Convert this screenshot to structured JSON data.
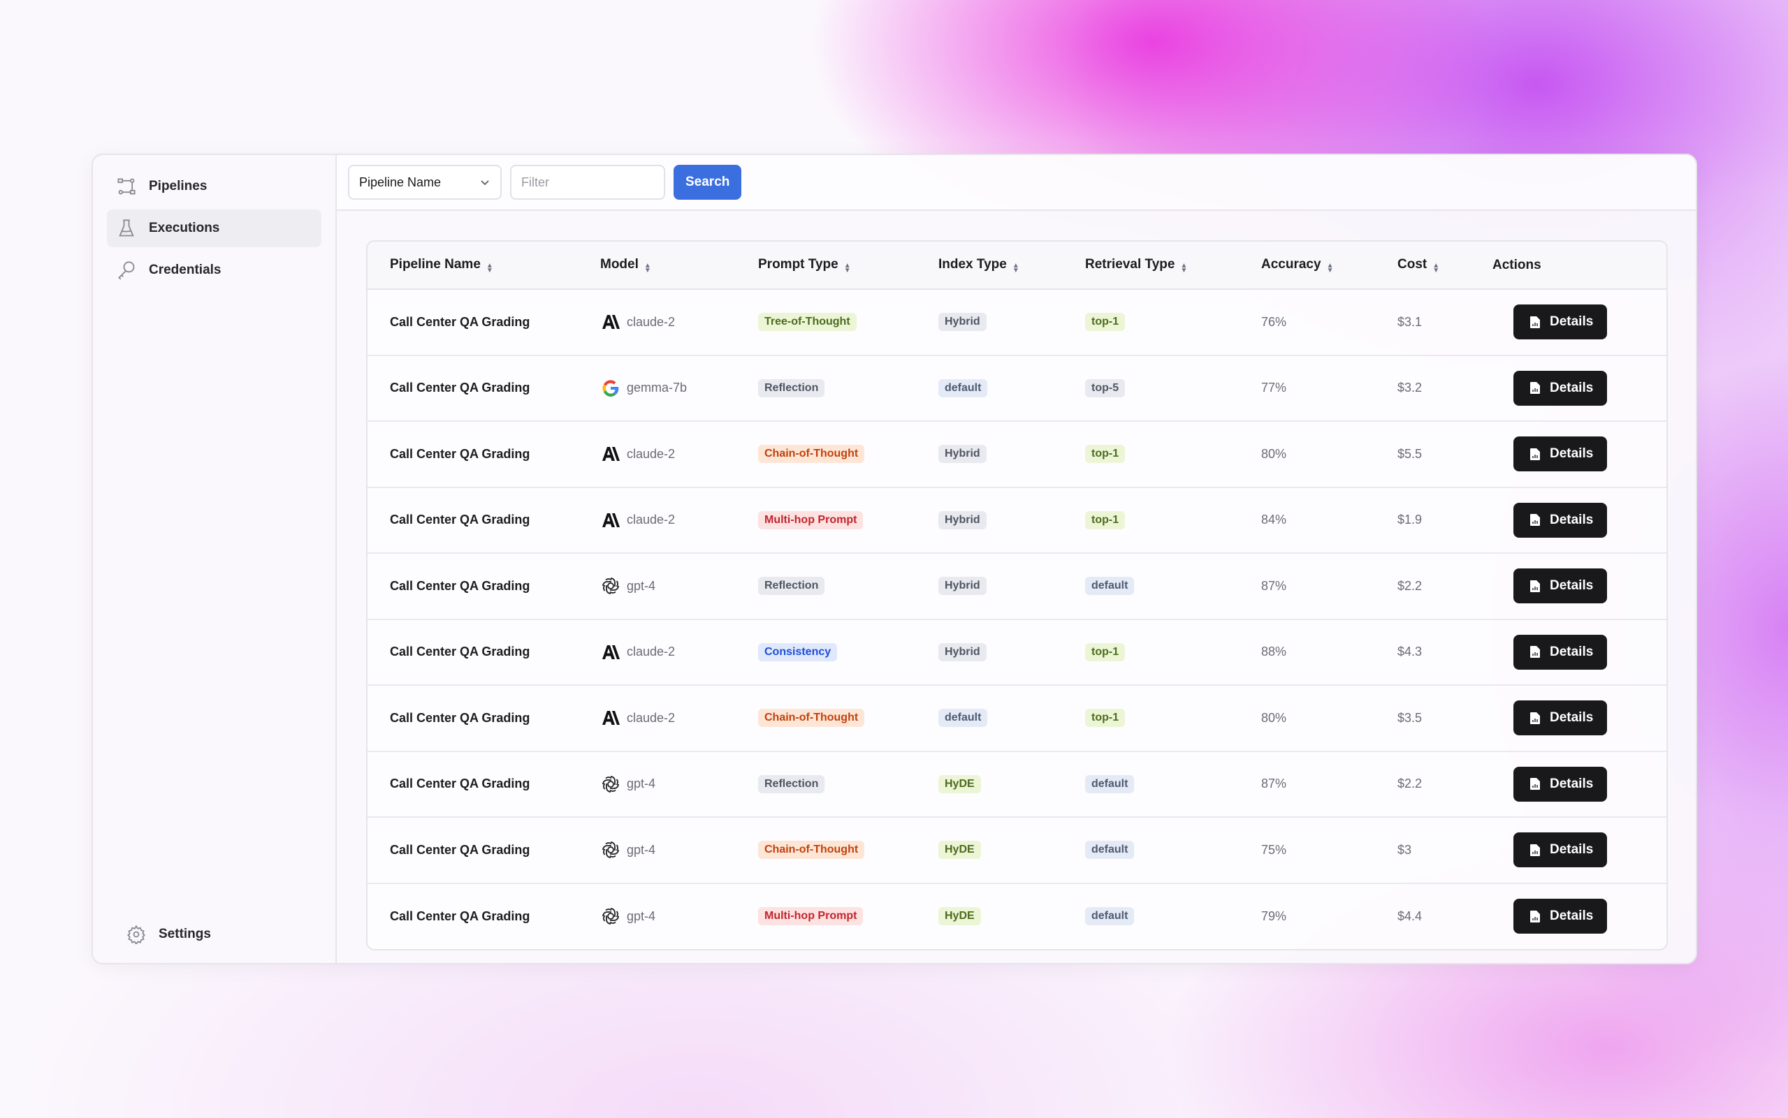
{
  "sidebar": {
    "items": [
      {
        "label": "Pipelines",
        "icon": "pipeline-icon"
      },
      {
        "label": "Executions",
        "icon": "flask-icon",
        "active": true
      },
      {
        "label": "Credentials",
        "icon": "key-icon"
      }
    ],
    "settings": {
      "label": "Settings",
      "icon": "gear-icon"
    }
  },
  "toolbar": {
    "select_value": "Pipeline Name",
    "filter_placeholder": "Filter",
    "search_label": "Search"
  },
  "table": {
    "columns": [
      "Pipeline Name",
      "Model",
      "Prompt Type",
      "Index Type",
      "Retrieval Type",
      "Accuracy",
      "Cost",
      "Actions"
    ],
    "action_label": "Details",
    "rows": [
      {
        "pipeline": "Call Center QA Grading",
        "model": "claude-2",
        "model_icon": "anthropic",
        "prompt": "Tree-of-Thought",
        "index": "Hybrid",
        "retrieval": "top-1",
        "accuracy": "76%",
        "cost": "$3.1"
      },
      {
        "pipeline": "Call Center QA Grading",
        "model": "gemma-7b",
        "model_icon": "google",
        "prompt": "Reflection",
        "index": "default",
        "retrieval": "top-5",
        "accuracy": "77%",
        "cost": "$3.2"
      },
      {
        "pipeline": "Call Center QA Grading",
        "model": "claude-2",
        "model_icon": "anthropic",
        "prompt": "Chain-of-Thought",
        "index": "Hybrid",
        "retrieval": "top-1",
        "accuracy": "80%",
        "cost": "$5.5"
      },
      {
        "pipeline": "Call Center QA Grading",
        "model": "claude-2",
        "model_icon": "anthropic",
        "prompt": "Multi-hop Prompt",
        "index": "Hybrid",
        "retrieval": "top-1",
        "accuracy": "84%",
        "cost": "$1.9"
      },
      {
        "pipeline": "Call Center QA Grading",
        "model": "gpt-4",
        "model_icon": "openai",
        "prompt": "Reflection",
        "index": "Hybrid",
        "retrieval": "default",
        "accuracy": "87%",
        "cost": "$2.2"
      },
      {
        "pipeline": "Call Center QA Grading",
        "model": "claude-2",
        "model_icon": "anthropic",
        "prompt": "Consistency",
        "index": "Hybrid",
        "retrieval": "top-1",
        "accuracy": "88%",
        "cost": "$4.3"
      },
      {
        "pipeline": "Call Center QA Grading",
        "model": "claude-2",
        "model_icon": "anthropic",
        "prompt": "Chain-of-Thought",
        "index": "default",
        "retrieval": "top-1",
        "accuracy": "80%",
        "cost": "$3.5"
      },
      {
        "pipeline": "Call Center QA Grading",
        "model": "gpt-4",
        "model_icon": "openai",
        "prompt": "Reflection",
        "index": "HyDE",
        "retrieval": "default",
        "accuracy": "87%",
        "cost": "$2.2"
      },
      {
        "pipeline": "Call Center QA Grading",
        "model": "gpt-4",
        "model_icon": "openai",
        "prompt": "Chain-of-Thought",
        "index": "HyDE",
        "retrieval": "default",
        "accuracy": "75%",
        "cost": "$3"
      },
      {
        "pipeline": "Call Center QA Grading",
        "model": "gpt-4",
        "model_icon": "openai",
        "prompt": "Multi-hop Prompt",
        "index": "HyDE",
        "retrieval": "default",
        "accuracy": "79%",
        "cost": "$4.4"
      }
    ]
  },
  "colors": {
    "accent": "#3b6fe0",
    "details_button": "#19191c"
  }
}
